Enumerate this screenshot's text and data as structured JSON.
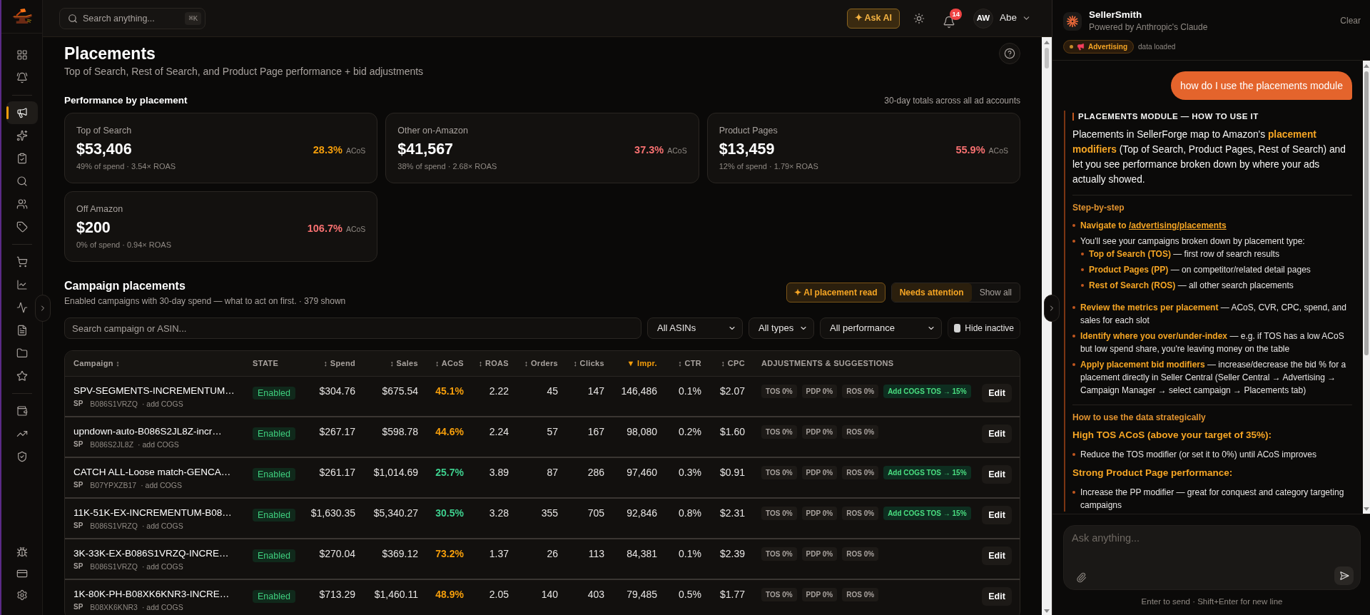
{
  "sidebar": {
    "groups": [
      {
        "items": [
          {
            "selected": false
          },
          {
            "selected": false
          }
        ]
      },
      {
        "items": [
          {
            "selected": true
          },
          {
            "selected": false
          },
          {
            "selected": false
          },
          {
            "selected": false
          },
          {
            "selected": false
          },
          {
            "selected": false
          }
        ]
      },
      {
        "items": [
          {
            "selected": false
          },
          {
            "selected": false
          },
          {
            "selected": false
          },
          {
            "selected": false
          },
          {
            "selected": false
          },
          {
            "selected": false
          }
        ]
      },
      {
        "items": [
          {
            "selected": false
          },
          {
            "selected": false
          },
          {
            "selected": false
          }
        ]
      }
    ],
    "bottom_items": [
      {
        "selected": false
      },
      {
        "selected": false
      },
      {
        "selected": false
      }
    ]
  },
  "top_bar": {
    "search": {
      "placeholder": "Search anything...",
      "shortcut": "⌘K"
    },
    "ask_ai": "✦ Ask AI",
    "notifications": {
      "count": "14"
    },
    "user": {
      "initials": "AW",
      "name": "Abe"
    }
  },
  "page": {
    "title": "Placements",
    "subtitle": "Top of Search, Rest of Search, and Product Page performance + bid adjustments"
  },
  "performance": {
    "title": "Performance by placement",
    "note": "30-day totals across all ad accounts",
    "cards": [
      {
        "label": "Top of Search",
        "value": "$53,406",
        "detail": "49% of spend · 3.54× ROAS",
        "acos": {
          "value": "28.3%",
          "color": "#f59e0b"
        },
        "acos_label": "ACoS"
      },
      {
        "label": "Other on-Amazon",
        "value": "$41,567",
        "detail": "38% of spend · 2.68× ROAS",
        "acos": {
          "value": "37.3%",
          "color": "#f87171"
        },
        "acos_label": "ACoS"
      },
      {
        "label": "Product Pages",
        "value": "$13,459",
        "detail": "12% of spend · 1.79× ROAS",
        "acos": {
          "value": "55.9%",
          "color": "#f87171"
        },
        "acos_label": "ACoS"
      },
      {
        "label": "Off Amazon",
        "value": "$200",
        "detail": "0% of spend · 0.94× ROAS",
        "acos": {
          "value": "106.7%",
          "color": "#f87171"
        },
        "acos_label": "ACoS"
      }
    ]
  },
  "campaigns": {
    "title": "Campaign placements",
    "subtitle": "Enabled campaigns with 30-day spend — what to act on first. · 379 shown",
    "ai_button": "✦ AI placement read",
    "view_toggle": [
      {
        "label": "Needs attention",
        "selected": true
      },
      {
        "label": "Show all",
        "selected": false
      }
    ],
    "filters": {
      "search_placeholder": "Search campaign or ASIN...",
      "selects": [
        "All ASINs",
        "All types",
        "All performance"
      ],
      "hide_inactive": {
        "label": "Hide inactive",
        "checked": false
      }
    },
    "table": {
      "columns": [
        {
          "label": "Campaign ↕",
          "selected": false
        },
        {
          "label": "STATE",
          "selected": false
        },
        {
          "label": "↕ Spend",
          "selected": false
        },
        {
          "label": "↕ Sales",
          "selected": false
        },
        {
          "label": "↕ ACoS",
          "selected": false
        },
        {
          "label": "↕ ROAS",
          "selected": false
        },
        {
          "label": "↕ Orders",
          "selected": false
        },
        {
          "label": "↕ Clicks",
          "selected": false
        },
        {
          "label": "▼ Impr.",
          "selected": true
        },
        {
          "label": "↕ CTR",
          "selected": false
        },
        {
          "label": "↕ CPC",
          "selected": false
        },
        {
          "label": "ADJUSTMENTS & SUGGESTIONS",
          "selected": false
        }
      ],
      "rows": [
        {
          "campaign": "SPV-SEGMENTS-INCREMENTUM…",
          "type": "SP",
          "asin": "B086S1VRZQ",
          "cogs_link": "· add COGS",
          "state": "Enabled",
          "spend": "$304.76",
          "sales": "$675.54",
          "acos": {
            "value": "45.1%",
            "color": "#f59e0b"
          },
          "roas": "2.22",
          "orders": "45",
          "clicks": "147",
          "impressions": "146,486",
          "ctr": "0.1%",
          "cpc": "$2.07",
          "adjustments": [
            "TOS 0%",
            "PDP 0%",
            "ROS 0%"
          ],
          "suggestion": "Add COGS TOS → 15%",
          "action": "Edit"
        },
        {
          "campaign": "upndown-auto-B086S2JL8Z-incr…",
          "type": "SP",
          "asin": "B086S2JL8Z",
          "cogs_link": "· add COGS",
          "state": "Enabled",
          "spend": "$267.17",
          "sales": "$598.78",
          "acos": {
            "value": "44.6%",
            "color": "#f59e0b"
          },
          "roas": "2.24",
          "orders": "57",
          "clicks": "167",
          "impressions": "98,080",
          "ctr": "0.2%",
          "cpc": "$1.60",
          "adjustments": [
            "TOS 0%",
            "PDP 0%",
            "ROS 0%"
          ],
          "action": "Edit"
        },
        {
          "campaign": "CATCH ALL-Loose match-GENCA…",
          "type": "SP",
          "asin": "B07YPXZB17",
          "cogs_link": "· add COGS",
          "state": "Enabled",
          "spend": "$261.17",
          "sales": "$1,014.69",
          "acos": {
            "value": "25.7%",
            "color": "#3ecf8e"
          },
          "roas": "3.89",
          "orders": "87",
          "clicks": "286",
          "impressions": "97,460",
          "ctr": "0.3%",
          "cpc": "$0.91",
          "adjustments": [
            "TOS 0%",
            "PDP 0%",
            "ROS 0%"
          ],
          "suggestion": "Add COGS TOS → 15%",
          "action": "Edit"
        },
        {
          "campaign": "11K-51K-EX-INCREMENTUM-B08…",
          "type": "SP",
          "asin": "B086S1VRZQ",
          "cogs_link": "· add COGS",
          "state": "Enabled",
          "spend": "$1,630.35",
          "sales": "$5,340.27",
          "acos": {
            "value": "30.5%",
            "color": "#3ecf8e"
          },
          "roas": "3.28",
          "orders": "355",
          "clicks": "705",
          "impressions": "92,846",
          "ctr": "0.8%",
          "cpc": "$2.31",
          "adjustments": [
            "TOS 0%",
            "PDP 0%",
            "ROS 0%"
          ],
          "suggestion": "Add COGS TOS → 15%",
          "action": "Edit"
        },
        {
          "campaign": "3K-33K-EX-B086S1VRZQ-INCRE…",
          "type": "SP",
          "asin": "B086S1VRZQ",
          "cogs_link": "· add COGS",
          "state": "Enabled",
          "spend": "$270.04",
          "sales": "$369.12",
          "acos": {
            "value": "73.2%",
            "color": "#f59e0b"
          },
          "roas": "1.37",
          "orders": "26",
          "clicks": "113",
          "impressions": "84,381",
          "ctr": "0.1%",
          "cpc": "$2.39",
          "adjustments": [
            "TOS 0%",
            "PDP 0%",
            "ROS 0%"
          ],
          "action": "Edit"
        },
        {
          "campaign": "1K-80K-PH-B08XK6KNR3-INCRE…",
          "type": "SP",
          "asin": "B08XK6KNR3",
          "cogs_link": "· add COGS",
          "state": "Enabled",
          "spend": "$713.29",
          "sales": "$1,460.11",
          "acos": {
            "value": "48.9%",
            "color": "#f59e0b"
          },
          "roas": "2.05",
          "orders": "140",
          "clicks": "403",
          "impressions": "79,485",
          "ctr": "0.5%",
          "cpc": "$1.77",
          "adjustments": [
            "TOS 0%",
            "PDP 0%",
            "ROS 0%"
          ],
          "action": "Edit"
        }
      ]
    }
  },
  "assistant_panel": {
    "title": "SellerSmith",
    "subtitle": "Powered by Anthropic's Claude",
    "clear": "Clear",
    "context_tag": {
      "label": "Advertising",
      "note": "data loaded"
    },
    "messages": [
      {
        "kind": "user",
        "text": "how do I use the placements module"
      },
      {
        "kind": "assistant",
        "blocks": [
          {
            "kind": "heading",
            "text": "PLACEMENTS MODULE — HOW TO USE IT"
          },
          {
            "kind": "paragraph",
            "text": "Placements in SellerForge map to Amazon's **placement modifiers** (Top of Search, Product Pages, Rest of Search) and let you see performance broken down by where your ads actually showed."
          },
          {
            "kind": "divider"
          },
          {
            "kind": "label",
            "text": "Step-by-step"
          },
          {
            "kind": "list",
            "items": [
              {
                "text": "**Navigate to**",
                "link": "/advertising/placements"
              },
              {
                "text": "You'll see your campaigns broken down by placement type:",
                "children": [
                  {
                    "text": "**Top of Search (TOS)** — first row of search results"
                  },
                  {
                    "text": "**Product Pages (PP)** — on competitor/related detail pages"
                  },
                  {
                    "text": "**Rest of Search (ROS)** — all other search placements"
                  }
                ]
              },
              {
                "text": "**Review the metrics per placement** — ACoS, CVR, CPC, spend, and sales for each slot"
              },
              {
                "text": "**Identify where you over/under-index** — e.g. if TOS has a low ACoS but low spend share, you're leaving money on the table"
              },
              {
                "text": "**Apply placement bid modifiers** — increase/decrease the bid % for a placement directly in Seller Central (Seller Central → Advertising → Campaign Manager → select campaign → Placements tab)"
              }
            ]
          },
          {
            "kind": "divider"
          },
          {
            "kind": "label",
            "text": "How to use the data strategically"
          },
          {
            "kind": "subheading",
            "text": "High TOS ACoS (above your target of 35%):"
          },
          {
            "kind": "list",
            "items": [
              {
                "text": "Reduce the TOS modifier (or set it to 0%) until ACoS improves"
              }
            ]
          },
          {
            "kind": "subheading",
            "text": "Strong Product Page performance:"
          },
          {
            "kind": "list",
            "items": [
              {
                "text": "Increase the PP modifier — great for conquest and category targeting campaigns"
              }
            ]
          }
        ]
      }
    ],
    "composer": {
      "placeholder": "Ask anything...",
      "hint": "Enter to send · Shift+Enter for new line"
    }
  }
}
